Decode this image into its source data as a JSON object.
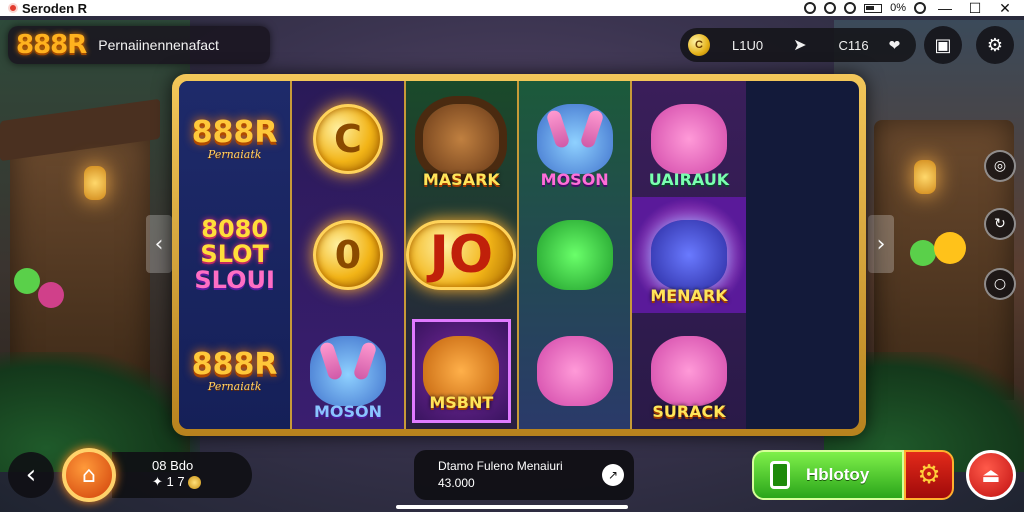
{
  "status_bar": {
    "app_title": "Seroden R",
    "battery": "0%"
  },
  "header": {
    "logo": "888R",
    "subtitle": "Pernaiinennenafact",
    "balance_coin": "C",
    "balance_value": "L1U0",
    "bet_value": "C116"
  },
  "reels": [
    [
      {
        "kind": "logo",
        "title": "888R",
        "sub": "Pernaiatk"
      },
      {
        "kind": "slot",
        "lines": [
          "8080",
          "SLOT",
          "SLOUI"
        ]
      },
      {
        "kind": "logo",
        "title": "888R",
        "sub": "Pernaiatk"
      }
    ],
    [
      {
        "kind": "coin",
        "glyph": "C"
      },
      {
        "kind": "coin",
        "glyph": "0"
      },
      {
        "kind": "creature",
        "label": "MOSON",
        "icon": "bunny-icon"
      }
    ],
    [
      {
        "kind": "creature",
        "label": "MASARK",
        "icon": "lion-icon"
      },
      {
        "kind": "coin",
        "glyph": "JO"
      },
      {
        "kind": "creature",
        "label": "MSBNT",
        "icon": "fox-icon"
      }
    ],
    [
      {
        "kind": "creature",
        "label": "MOSON",
        "icon": "bunny-icon"
      },
      {
        "kind": "creature",
        "label": "",
        "icon": "dino-icon"
      },
      {
        "kind": "creature",
        "label": "",
        "icon": "pig-icon"
      }
    ],
    [
      {
        "kind": "creature",
        "label": "UAIRAUK",
        "icon": "pig-icon"
      },
      {
        "kind": "creature",
        "label": "MENARK",
        "icon": "cat-icon"
      },
      {
        "kind": "creature",
        "label": "SURACK",
        "icon": "pig-icon"
      }
    ]
  ],
  "bottom": {
    "bet_line1": "08 Bdo",
    "bet_line2": "1 7",
    "info_line1": "Dtamo Fuleno Menaiuri",
    "info_line2": "43.000",
    "play_label": "Hblotoy"
  },
  "colors": {
    "accent_gold": "#f3c75a",
    "play_green": "#2aa51a",
    "danger_red": "#c01010"
  }
}
